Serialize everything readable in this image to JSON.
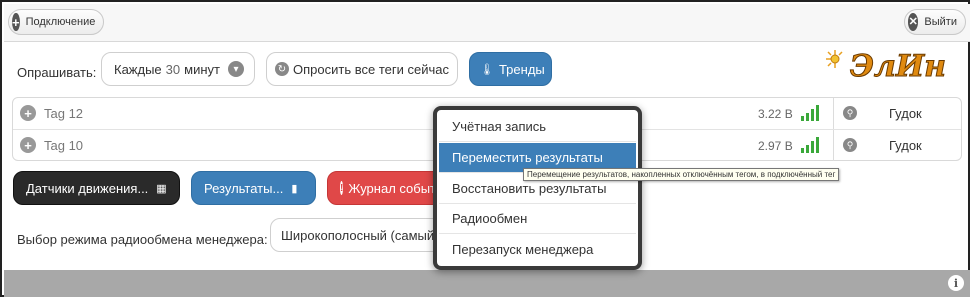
{
  "topbar": {
    "connect_label": "Подключение",
    "exit_label": "Выйти"
  },
  "polling": {
    "label": "Опрашивать:",
    "interval_prefix": "Каждые",
    "interval_value": "30",
    "interval_suffix": "минут",
    "poll_all_label": "Опросить все теги сейчас",
    "trends_label": "Тренды"
  },
  "logo": {
    "text": "ЭлИн"
  },
  "tags": [
    {
      "name": "Tag 12",
      "voltage": "3.22 В",
      "beep_label": "Гудок"
    },
    {
      "name": "Tag 10",
      "voltage": "2.97 В",
      "beep_label": "Гудок"
    }
  ],
  "actions": {
    "motion_sensors_label": "Датчики движения...",
    "results_label": "Результаты...",
    "event_log_label": "Журнал событий"
  },
  "radio_mode": {
    "label": "Выбор режима радиообмена менеджера:",
    "selected": "Широкополосный (самый быстрый)"
  },
  "context_menu": {
    "items": [
      "Учётная запись",
      "Переместить результаты",
      "Восстановить результаты",
      "Радиообмен",
      "Перезапуск менеджера"
    ],
    "active_index": 1
  },
  "tooltip": {
    "text": "Перемещение результатов, накопленных отключённым тегом, в подключённый тег"
  },
  "colors": {
    "accent_blue": "#3d7fb8",
    "danger_red": "#e04848",
    "dark_button": "#2a2a2a",
    "signal_green": "#3aa83a",
    "footer_gray": "#a8a8a8"
  }
}
